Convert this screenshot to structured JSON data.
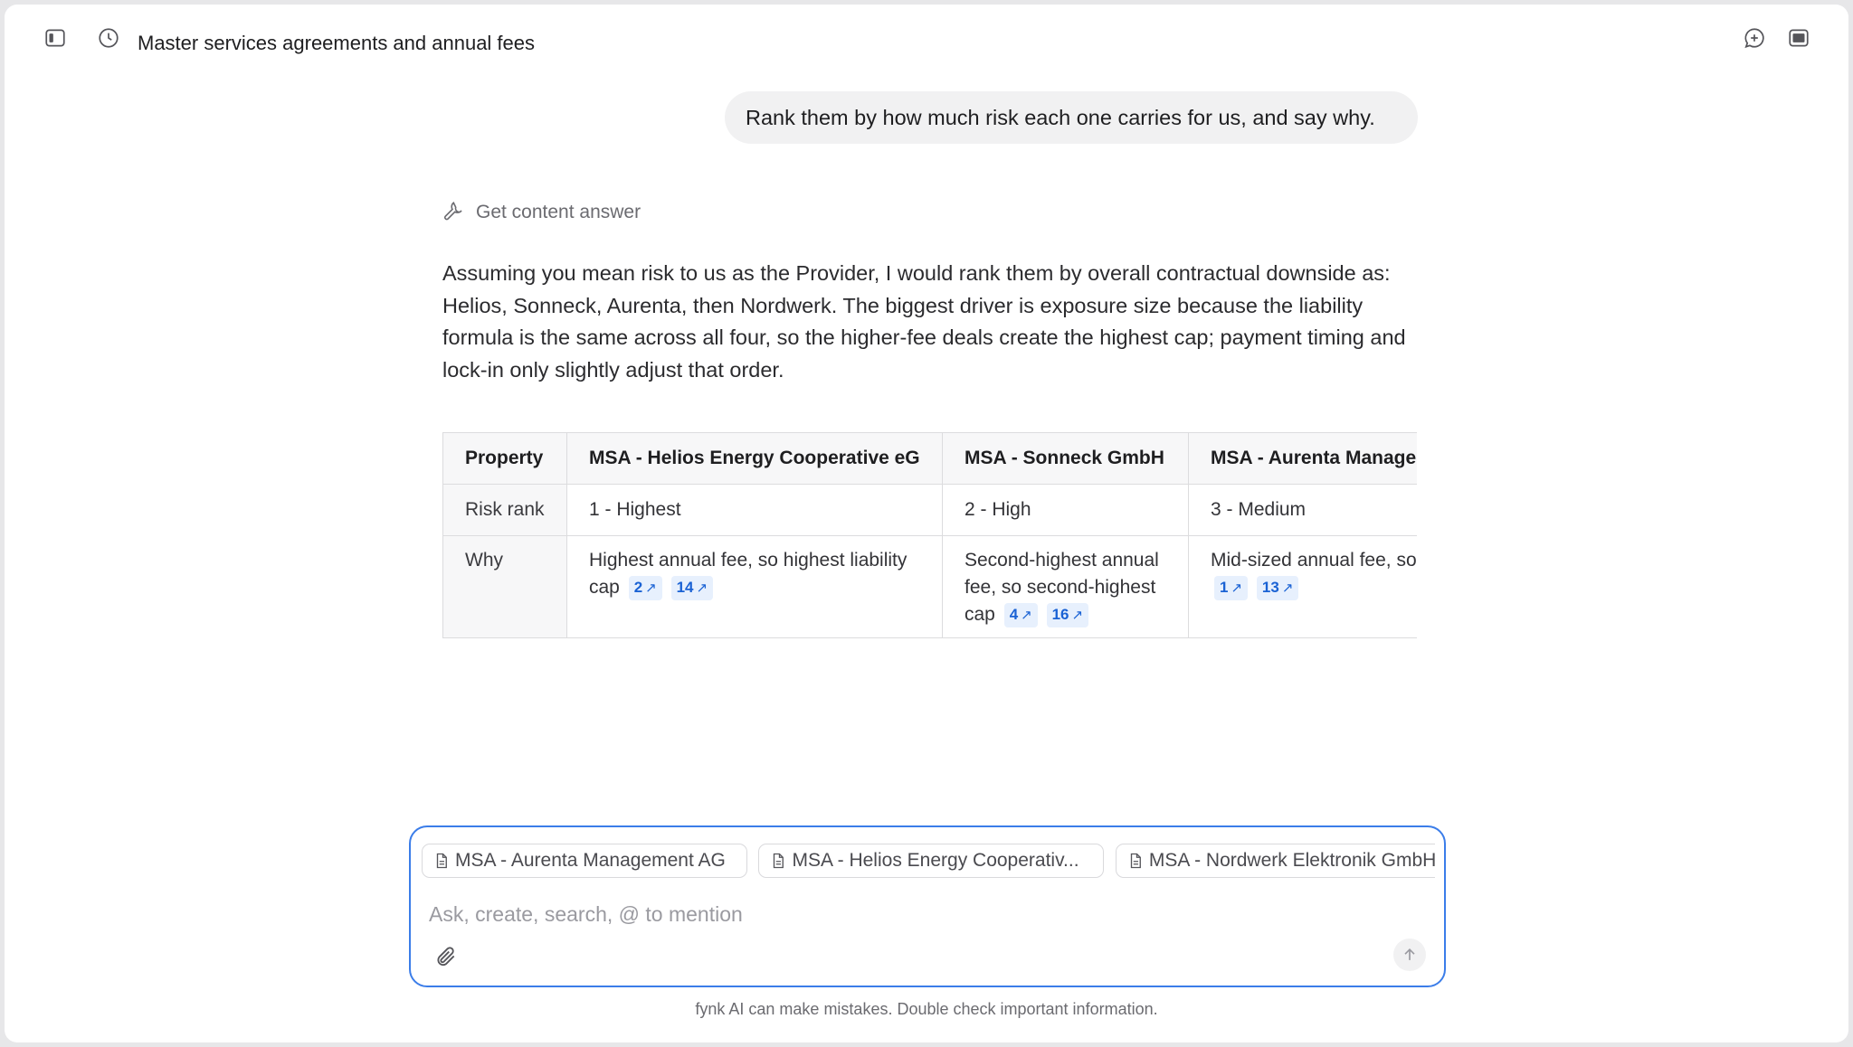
{
  "header": {
    "title": "Master services agreements and annual fees",
    "icons": [
      "sidebar-toggle-icon",
      "history-clock-icon",
      "new-chat-icon",
      "panel-icon"
    ]
  },
  "conversation": {
    "user_message": "Rank them by how much risk each one carries for us, and say why.",
    "tool_label": "Get content answer",
    "answer": "Assuming you mean risk to us as the Provider, I would rank them by overall contractual downside as: Helios, Sonneck, Aurenta, then Nordwerk. The biggest driver is exposure size because the liability formula is the same across all four, so the higher-fee deals create the highest cap; payment timing and lock-in only slightly adjust that order.",
    "table": {
      "headers": [
        "Property",
        "MSA - Helios Energy Cooperative eG",
        "MSA - Sonneck GmbH",
        "MSA - Aurenta Management AG"
      ],
      "rows": [
        {
          "property": "Risk rank",
          "cells": [
            {
              "text": "1 - Highest",
              "citations": []
            },
            {
              "text": "2 - High",
              "citations": []
            },
            {
              "text": "3 - Medium",
              "citations": []
            }
          ]
        },
        {
          "property": "Why",
          "cells": [
            {
              "text": "Highest annual fee, so highest liability cap",
              "citations": [
                "2",
                "14"
              ]
            },
            {
              "text": "Second-highest annual fee, so second-highest cap",
              "citations": [
                "4",
                "16"
              ]
            },
            {
              "text": "Mid-sized annual fee, so mid-sized cap",
              "citations": [
                "1",
                "13"
              ]
            }
          ]
        }
      ]
    }
  },
  "composer": {
    "chips": [
      "MSA - Aurenta Management AG",
      "MSA - Helios Energy Cooperativ...",
      "MSA - Nordwerk Elektronik GmbH"
    ],
    "placeholder": "Ask, create, search, @ to mention",
    "value": ""
  },
  "footer": {
    "disclaimer": "fynk AI can make mistakes. Double check important information."
  },
  "colors": {
    "accent": "#3b7de9",
    "citation_bg": "#e7f0fd",
    "citation_text": "#1a62d4",
    "bubble_bg": "#f1f1f2"
  }
}
